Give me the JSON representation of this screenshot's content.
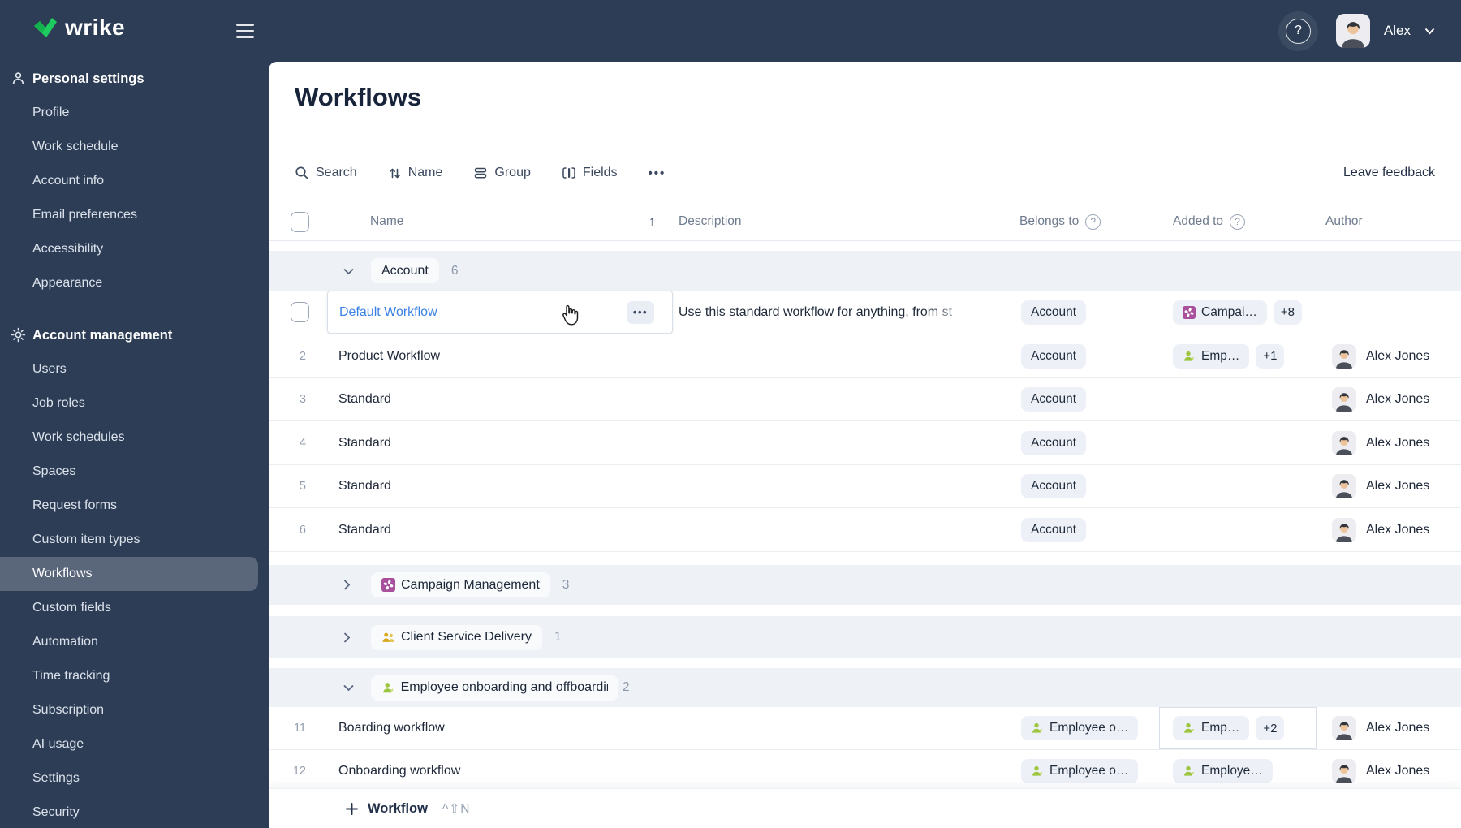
{
  "topbar": {
    "logo": "wrike",
    "help": "?",
    "user_name": "Alex"
  },
  "sidebar": {
    "selected_item": "Workflows",
    "sections": [
      {
        "label": "Personal settings",
        "items": [
          "Profile",
          "Work schedule",
          "Account info",
          "Email preferences",
          "Accessibility",
          "Appearance"
        ]
      },
      {
        "label": "Account management",
        "items": [
          "Users",
          "Job roles",
          "Work schedules",
          "Spaces",
          "Request forms",
          "Custom item types",
          "Workflows",
          "Custom fields",
          "Automation",
          "Time tracking",
          "Subscription",
          "AI usage",
          "Settings",
          "Security"
        ]
      }
    ]
  },
  "main": {
    "title": "Workflows",
    "toolbar": {
      "search": "Search",
      "sort": "Name",
      "group": "Group",
      "fields": "Fields",
      "more": "•••",
      "feedback": "Leave feedback"
    },
    "table": {
      "headers": {
        "name": "Name",
        "sort_arrow": "↑",
        "description": "Description",
        "belongs_to": "Belongs to",
        "added_to": "Added to",
        "author": "Author",
        "help": "?"
      },
      "groups": [
        {
          "label": "Account",
          "count": "6",
          "icon": "none"
        },
        {
          "label": "Campaign Management",
          "count": "3",
          "icon": "campaign"
        },
        {
          "label": "Client Service Delivery",
          "count": "1",
          "icon": "client"
        },
        {
          "label": "Employee onboarding and offboardin",
          "count": "2",
          "icon": "employee"
        }
      ],
      "rows": [
        {
          "name": "Default Workflow",
          "more": "•••",
          "description": "Use this standard workflow for anything, from st",
          "belongs_to": "Account",
          "added_to": "Campai…",
          "added_more": "+8",
          "author": ""
        },
        {
          "num": "2",
          "name": "Product Workflow",
          "belongs_to": "Account",
          "added_to": "Emp…",
          "added_more": "+1",
          "author": "Alex Jones"
        },
        {
          "num": "3",
          "name": "Standard",
          "belongs_to": "Account",
          "author": "Alex Jones"
        },
        {
          "num": "4",
          "name": "Standard",
          "belongs_to": "Account",
          "author": "Alex Jones"
        },
        {
          "num": "5",
          "name": "Standard",
          "belongs_to": "Account",
          "author": "Alex Jones"
        },
        {
          "num": "6",
          "name": "Standard",
          "belongs_to": "Account",
          "author": "Alex Jones"
        },
        {
          "num": "11",
          "name": "Boarding workflow",
          "belongs_to": "Employee o…",
          "added_to": "Emp…",
          "added_more": "+2",
          "author": "Alex Jones"
        },
        {
          "num": "12",
          "name": "Onboarding workflow",
          "belongs_to": "Employee o…",
          "added_to": "Employe…",
          "author": "Alex Jones"
        }
      ]
    },
    "footer": {
      "add": "Workflow",
      "shortcut": "^⇧N"
    },
    "colors": {
      "brand_green": "#1ecb5f",
      "navy": "#2c3d55",
      "link_blue": "#3a82e4",
      "band": "#eef1f6",
      "pill": "#edf1f7",
      "campaign": "#a9509c",
      "client": "#d9a81f",
      "employee": "#9dc53e"
    }
  }
}
